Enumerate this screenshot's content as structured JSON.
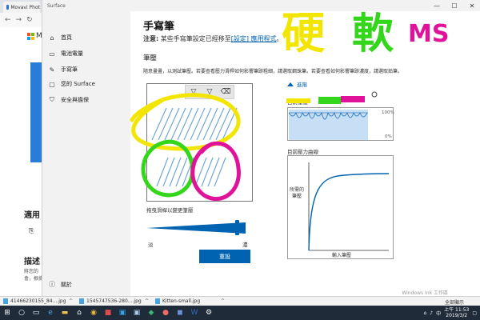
{
  "browser": {
    "tab_title": "Movavi Phot",
    "ms_text": "M",
    "heading_1": "適用",
    "heading_2": "描述",
    "para_1": "將您的",
    "para_2": "會，根據"
  },
  "window": {
    "title": "Surface",
    "controls": [
      "—",
      "☐",
      "✕"
    ]
  },
  "sidebar": {
    "items": [
      {
        "icon": "home-icon",
        "glyph": "⌂",
        "label": "首頁"
      },
      {
        "icon": "battery-icon",
        "glyph": "▭",
        "label": "電池電量"
      },
      {
        "icon": "pen-icon",
        "glyph": "✎",
        "label": "手寫筆"
      },
      {
        "icon": "surface-icon",
        "glyph": "▢",
        "label": "您的 Surface"
      },
      {
        "icon": "shield-icon",
        "glyph": "⛉",
        "label": "安全與擔保"
      }
    ],
    "about": {
      "icon": "info-icon",
      "glyph": "ⓘ",
      "label": "關於"
    }
  },
  "main": {
    "title": "手寫筆",
    "note_bold": "注意:",
    "note_text": "某些手寫筆設定已經移至",
    "note_link": "[設定] 應用程式",
    "note_end": "。",
    "section": "筆壓",
    "description": "隨意畫畫，以測試筆壓。若要查看壓力滑桿如何影響筆跡粗細，請選取鋼珠筆。若要查看如何影響筆跡濃度，請選取鉛筆。",
    "tools": [
      {
        "icon": "ballpoint-pen-icon",
        "glyph": "▽"
      },
      {
        "icon": "pencil-icon",
        "glyph": "▽"
      },
      {
        "icon": "eraser-icon",
        "glyph": "⌫"
      }
    ],
    "slider_label": "拖曳滑桿以變更筆壓",
    "slider_min": "淡",
    "slider_max": "濃",
    "slider_value": 0.88,
    "reset_button": "重設",
    "advanced": "進階",
    "current_pressure_label": "目前筆壓",
    "pct_max": "100%",
    "pct_min": "0%",
    "curve_label": "目前壓力曲線",
    "curve_y_label": "所需的筆壓",
    "curve_x_label": "輸入筆壓"
  },
  "downloads": {
    "items": [
      "41466230155_84....jpg",
      "1545747536-280....jpg",
      "Kitten-small.jpg"
    ],
    "show_all": "全部顯示",
    "watermark": "Windows Ink 工作區"
  },
  "taskbar": {
    "time": "上午 11:53",
    "date": "2019/3/2",
    "lang": "中"
  },
  "annotation": {
    "text_1": "硬",
    "text_2": "軟",
    "text_3": "MS",
    "colors": {
      "yellow": "#f2e600",
      "green": "#33d61a",
      "magenta": "#e0129a",
      "accent": "#0063b1"
    }
  }
}
